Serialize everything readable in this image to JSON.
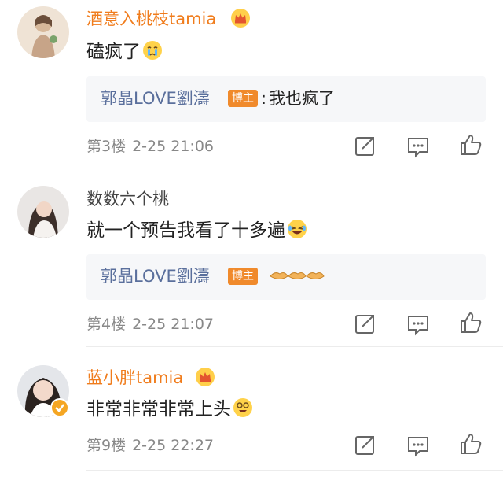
{
  "comments": [
    {
      "username": "酒意入桃枝tamia",
      "vip": true,
      "text": "磕疯了",
      "emoji": "crying-emoji",
      "reply": {
        "author": "郭晶LOVE劉濤",
        "badge": "博主",
        "separator": ":",
        "text": "我也疯了"
      },
      "floor": "第3楼",
      "time": "2-25 21:06"
    },
    {
      "username": "数数六个桃",
      "vip": false,
      "text": "就一个预告我看了十多遍",
      "emoji": "laughing-tears-emoji",
      "reply": {
        "author": "郭晶LOVE劉濤",
        "badge": "博主",
        "separator": "",
        "text": "",
        "emoji": "handshake-emoji"
      },
      "floor": "第4楼",
      "time": "2-25 21:07"
    },
    {
      "username": "蓝小胖tamia",
      "vip": true,
      "text": "非常非常非常上头",
      "emoji": "dizzy-smile-emoji",
      "floor": "第9楼",
      "time": "2-25 22:27"
    }
  ],
  "colors": {
    "vip_name": "#f07c1c",
    "reply_name": "#5a6f9c",
    "badge": "#f08a2c",
    "meta": "#888888"
  },
  "icons": [
    "share-icon",
    "comment-icon",
    "like-icon",
    "crown-icon",
    "verified-badge-icon"
  ]
}
